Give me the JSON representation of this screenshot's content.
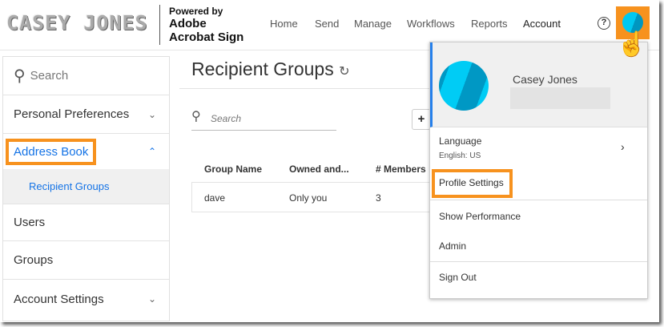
{
  "header": {
    "logo": "CASEY JONES",
    "powered": "Powered by",
    "brand_line1": "Adobe",
    "brand_line2": "Acrobat Sign",
    "nav": [
      "Home",
      "Send",
      "Manage",
      "Workflows",
      "Reports",
      "Account"
    ],
    "help": "?"
  },
  "sidebar": {
    "search": "Search",
    "items": [
      "Personal Preferences",
      "Address Book",
      "Recipient Groups",
      "Users",
      "Groups",
      "Account Settings"
    ]
  },
  "main": {
    "title": "Recipient Groups",
    "search_placeholder": "Search",
    "add": "+",
    "columns": [
      "Group Name",
      "Owned and...",
      "# Members"
    ],
    "rows": [
      {
        "name": "dave",
        "owner": "Only you",
        "members": "3"
      }
    ]
  },
  "menu": {
    "name": "Casey Jones",
    "language_label": "Language",
    "language_value": "English: US",
    "items": [
      "Profile Settings",
      "Show Performance",
      "Admin",
      "Sign Out"
    ]
  },
  "colors": {
    "highlight": "#f7921e",
    "accent": "#1473e6"
  }
}
